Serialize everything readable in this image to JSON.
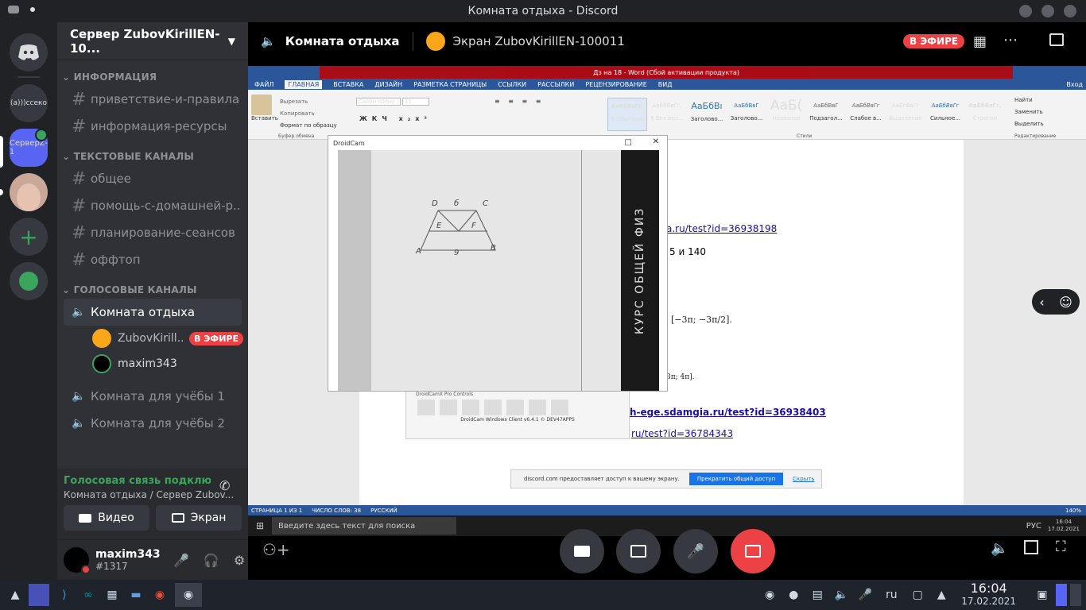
{
  "window": {
    "title": "Комната отдыха - Discord"
  },
  "guilds": [
    {
      "name": "Discord"
    },
    {
      "name": "(а)))ссеко"
    },
    {
      "name": "СерверZ-1"
    },
    {
      "name": "avatar"
    },
    {
      "name": "add"
    },
    {
      "name": "explore"
    }
  ],
  "server": {
    "name": "Сервер ZubovKirillEN-10..."
  },
  "categories": {
    "info": "ИНФОРМАЦИЯ",
    "text": "ТЕКСТОВЫЕ КАНАЛЫ",
    "voice": "ГОЛОСОВЫЕ КАНАЛЫ"
  },
  "info_channels": [
    "приветствие-и-правила",
    "информация-ресурсы"
  ],
  "text_channels": [
    "общее",
    "помощь-с-домашней-р...",
    "планирование-сеансов",
    "оффтоп"
  ],
  "voice_channels": [
    "Комната отдыха",
    "Комната для учёбы 1",
    "Комната для учёбы 2"
  ],
  "voice_users": [
    {
      "name": "ZubovKirill...",
      "badge": "В ЭФИРЕ"
    },
    {
      "name": "maxim343",
      "badge": ""
    }
  ],
  "voice_status": {
    "title": "Голосовая связь подключ",
    "sub": "Комната отдыха / Сервер Zubov...",
    "video": "Видео",
    "screen": "Экран"
  },
  "user": {
    "name": "maxim343",
    "tag": "#1317"
  },
  "topbar": {
    "channel": "Комната отдыха",
    "stream": "Экран ZubovKirillEN-100011",
    "live": "В ЭФИРЕ"
  },
  "word": {
    "title": "Дз на 18 - Word (Сбой активации продукта)",
    "tabs": [
      "ФАЙЛ",
      "ГЛАВНАЯ",
      "ВСТАВКА",
      "ДИЗАЙН",
      "РАЗМЕТКА СТРАНИЦЫ",
      "ССЫЛКИ",
      "РАССЫЛКИ",
      "РЕЦЕНЗИРОВАНИЕ",
      "ВИД"
    ],
    "login": "Вход",
    "clipboard": {
      "paste": "Вставить",
      "cut": "Вырезать",
      "copy": "Копировать",
      "format": "Формат по образцу",
      "group": "Буфер обмена"
    },
    "font": {
      "name": "Calibri (Осно",
      "size": "11"
    },
    "styles": [
      {
        "s": "АаБбВвГг,",
        "n": "¶ Обычный"
      },
      {
        "s": "АаБбВвГг,",
        "n": "¶ Без инт..."
      },
      {
        "s": "АаБбВı",
        "n": "Заголово..."
      },
      {
        "s": "АаБбВвГ",
        "n": "Заголово..."
      },
      {
        "s": "АаБ(",
        "n": "Название"
      },
      {
        "s": "АаБбВвГ",
        "n": "Подзагол..."
      },
      {
        "s": "АаБбВвГг",
        "n": "Слабое в..."
      },
      {
        "s": "АаБбВвГг",
        "n": "Выделение"
      },
      {
        "s": "АаБбВвГг",
        "n": "Сильное..."
      },
      {
        "s": "АаБбВвГг,",
        "n": "Строгий"
      }
    ],
    "styles_group": "Стили",
    "edit": {
      "find": "Найти",
      "replace": "Заменить",
      "select": "Выделить",
      "group": "Редактирование"
    },
    "doc_text": [
      "a.ru/test?id=36938198",
      "5 и 140",
      "h-ege.sdamgia.ru/test?id=36938403",
      "ru/test?id=36784343",
      "[−3π; −3π/2].",
      "3π; 4π]."
    ],
    "share_bar": {
      "text": "discord.com предоставляет доступ к вашему экрану.",
      "stop": "Прекратить общий доступ",
      "hide": "Скрыть"
    },
    "status": {
      "page": "СТРАНИЦА 1 ИЗ 1",
      "words": "ЧИСЛО СЛОВ: 38",
      "lang": "РУССКИЙ",
      "zoom": "140%"
    },
    "taskbar": {
      "search": "Введите здесь текст для поиска",
      "lang": "РУС",
      "time": "16:04",
      "date": "17.02.2021"
    }
  },
  "droidcam": {
    "title": "DroidCam",
    "pro": "DroidCamX Pro Controls",
    "footer": "DroidCam Windows Client v6.4.1 © DEV47APPS",
    "sketch_labels": [
      "D",
      "б",
      "C",
      "E",
      "F",
      "A",
      "9",
      "B"
    ],
    "book": "КУРС ОБЩЕЙ ФИЗ"
  },
  "system": {
    "lang": "ru",
    "time": "16:04",
    "date": "17.02.2021"
  }
}
